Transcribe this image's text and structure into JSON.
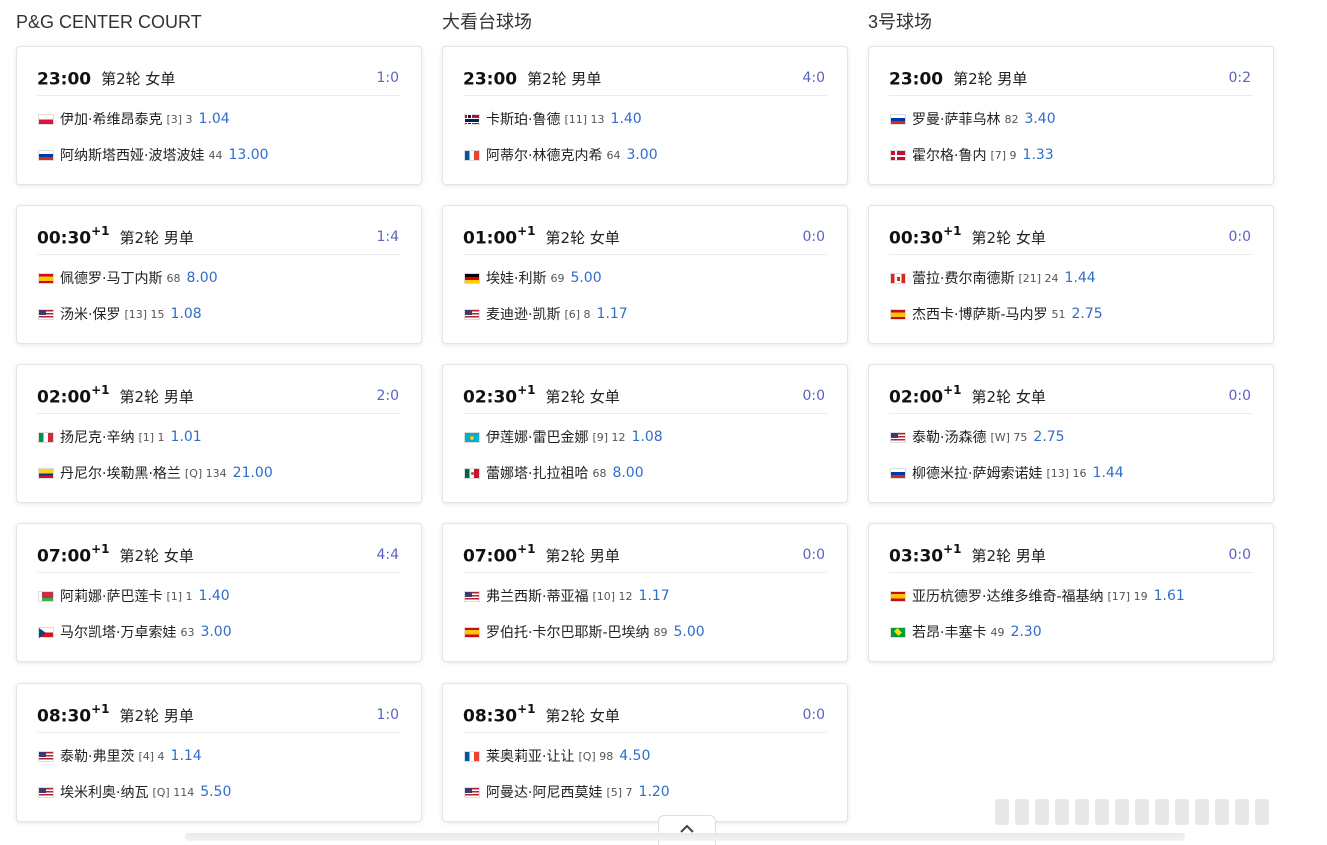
{
  "columns": [
    {
      "title": "P&G CENTER COURT",
      "matches": [
        {
          "time": "23:00",
          "day": "",
          "round": "第2轮 女单",
          "score": "1:0",
          "p1": {
            "flag": "poland",
            "name": "伊加·希维昂泰克",
            "seed": "[3]",
            "rank": "3",
            "odds": "1.04"
          },
          "p2": {
            "flag": "russia",
            "name": "阿纳斯塔西娅·波塔波娃",
            "seed": "",
            "rank": "44",
            "odds": "13.00"
          }
        },
        {
          "time": "00:30",
          "day": "+1",
          "round": "第2轮 男单",
          "score": "1:4",
          "p1": {
            "flag": "spain",
            "name": "佩德罗·马丁内斯",
            "seed": "",
            "rank": "68",
            "odds": "8.00"
          },
          "p2": {
            "flag": "usa",
            "name": "汤米·保罗",
            "seed": "[13]",
            "rank": "15",
            "odds": "1.08"
          }
        },
        {
          "time": "02:00",
          "day": "+1",
          "round": "第2轮 男单",
          "score": "2:0",
          "p1": {
            "flag": "italy",
            "name": "扬尼克·辛纳",
            "seed": "[1]",
            "rank": "1",
            "odds": "1.01"
          },
          "p2": {
            "flag": "colombia",
            "name": "丹尼尔·埃勒黑·格兰",
            "seed": "[Q]",
            "rank": "134",
            "odds": "21.00"
          }
        },
        {
          "time": "07:00",
          "day": "+1",
          "round": "第2轮 女单",
          "score": "4:4",
          "p1": {
            "flag": "belarus",
            "name": "阿莉娜·萨巴莲卡",
            "seed": "[1]",
            "rank": "1",
            "odds": "1.40"
          },
          "p2": {
            "flag": "czech",
            "name": "马尔凯塔·万卓索娃",
            "seed": "",
            "rank": "63",
            "odds": "3.00"
          }
        },
        {
          "time": "08:30",
          "day": "+1",
          "round": "第2轮 男单",
          "score": "1:0",
          "p1": {
            "flag": "usa",
            "name": "泰勒·弗里茨",
            "seed": "[4]",
            "rank": "4",
            "odds": "1.14"
          },
          "p2": {
            "flag": "usa",
            "name": "埃米利奥·纳瓦",
            "seed": "[Q]",
            "rank": "114",
            "odds": "5.50"
          }
        }
      ]
    },
    {
      "title": "大看台球场",
      "matches": [
        {
          "time": "23:00",
          "day": "",
          "round": "第2轮 男单",
          "score": "4:0",
          "p1": {
            "flag": "norway",
            "name": "卡斯珀·鲁德",
            "seed": "[11]",
            "rank": "13",
            "odds": "1.40"
          },
          "p2": {
            "flag": "france",
            "name": "阿蒂尔·林德克内希",
            "seed": "",
            "rank": "64",
            "odds": "3.00"
          }
        },
        {
          "time": "01:00",
          "day": "+1",
          "round": "第2轮 女单",
          "score": "0:0",
          "p1": {
            "flag": "germany",
            "name": "埃娃·利斯",
            "seed": "",
            "rank": "69",
            "odds": "5.00"
          },
          "p2": {
            "flag": "usa",
            "name": "麦迪逊·凯斯",
            "seed": "[6]",
            "rank": "8",
            "odds": "1.17"
          }
        },
        {
          "time": "02:30",
          "day": "+1",
          "round": "第2轮 女单",
          "score": "0:0",
          "p1": {
            "flag": "kazakhstan",
            "name": "伊莲娜·雷巴金娜",
            "seed": "[9]",
            "rank": "12",
            "odds": "1.08"
          },
          "p2": {
            "flag": "mexico",
            "name": "蕾娜塔·扎拉祖哈",
            "seed": "",
            "rank": "68",
            "odds": "8.00"
          }
        },
        {
          "time": "07:00",
          "day": "+1",
          "round": "第2轮 男单",
          "score": "0:0",
          "p1": {
            "flag": "usa",
            "name": "弗兰西斯·蒂亚福",
            "seed": "[10]",
            "rank": "12",
            "odds": "1.17"
          },
          "p2": {
            "flag": "spain",
            "name": "罗伯托·卡尔巴耶斯-巴埃纳",
            "seed": "",
            "rank": "89",
            "odds": "5.00"
          }
        },
        {
          "time": "08:30",
          "day": "+1",
          "round": "第2轮 女单",
          "score": "0:0",
          "p1": {
            "flag": "france",
            "name": "莱奥莉亚·让让",
            "seed": "[Q]",
            "rank": "98",
            "odds": "4.50"
          },
          "p2": {
            "flag": "usa",
            "name": "阿曼达·阿尼西莫娃",
            "seed": "[5]",
            "rank": "7",
            "odds": "1.20"
          }
        }
      ]
    },
    {
      "title": "3号球场",
      "matches": [
        {
          "time": "23:00",
          "day": "",
          "round": "第2轮 男单",
          "score": "0:2",
          "p1": {
            "flag": "russia",
            "name": "罗曼·萨菲乌林",
            "seed": "",
            "rank": "82",
            "odds": "3.40"
          },
          "p2": {
            "flag": "denmark",
            "name": "霍尔格·鲁内",
            "seed": "[7]",
            "rank": "9",
            "odds": "1.33"
          }
        },
        {
          "time": "00:30",
          "day": "+1",
          "round": "第2轮 女单",
          "score": "0:0",
          "p1": {
            "flag": "canada",
            "name": "蕾拉·费尔南德斯",
            "seed": "[21]",
            "rank": "24",
            "odds": "1.44"
          },
          "p2": {
            "flag": "spain",
            "name": "杰西卡·博萨斯-马内罗",
            "seed": "",
            "rank": "51",
            "odds": "2.75"
          }
        },
        {
          "time": "02:00",
          "day": "+1",
          "round": "第2轮 女单",
          "score": "0:0",
          "p1": {
            "flag": "usa",
            "name": "泰勒·汤森德",
            "seed": "[W]",
            "rank": "75",
            "odds": "2.75"
          },
          "p2": {
            "flag": "russia",
            "name": "柳德米拉·萨姆索诺娃",
            "seed": "[13]",
            "rank": "16",
            "odds": "1.44"
          }
        },
        {
          "time": "03:30",
          "day": "+1",
          "round": "第2轮 男单",
          "score": "0:0",
          "p1": {
            "flag": "spain",
            "name": "亚历杭德罗·达维多维奇-福基纳",
            "seed": "[17]",
            "rank": "19",
            "odds": "1.61"
          },
          "p2": {
            "flag": "brazil",
            "name": "若昂·丰塞卡",
            "seed": "",
            "rank": "49",
            "odds": "2.30"
          }
        }
      ]
    }
  ],
  "collapse_icon": "chevron-up-icon",
  "colors": {
    "score": "#5b63c4",
    "odds": "#2f6dcc"
  }
}
